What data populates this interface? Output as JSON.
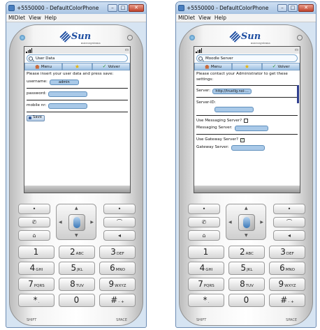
{
  "windows": [
    {
      "title": "+5550000 - DefaultColorPhone",
      "menu": [
        "MIDlet",
        "View",
        "Help"
      ],
      "search_label": "User Data",
      "nav": {
        "menu": "Menu",
        "back": "Volver"
      },
      "intro": "Please insert your user data and press save:",
      "fields": [
        {
          "label": "username:",
          "value": "admin"
        },
        {
          "label": "password:",
          "value": ""
        },
        {
          "label": "mobile nr:",
          "value": ""
        }
      ],
      "save_label": "Save"
    },
    {
      "title": "+5550000 - DefaultColorPhone",
      "menu": [
        "MIDlet",
        "View",
        "Help"
      ],
      "search_label": "Moodle Server",
      "nav": {
        "menu": "Menu",
        "back": "Volver"
      },
      "intro": "Please contact your Administrator to get these settings:",
      "server": {
        "label": "Server:",
        "value": "http://trustlg.noi-..."
      },
      "server_id": {
        "label": "Server-ID:",
        "value": ""
      },
      "messaging": {
        "checkbox_label": "Use Messaging Server?",
        "checked": false,
        "server_label": "Messaging Server:",
        "value": ""
      },
      "gateway": {
        "checkbox_label": "Use Gateway Server?",
        "checked": true,
        "server_label": "Gateway Server:",
        "value": ""
      }
    }
  ],
  "phone": {
    "brand": "Sun",
    "brand_sub": "microsystems",
    "keys": [
      {
        "n": "1",
        "l": ""
      },
      {
        "n": "2",
        "l": "ABC"
      },
      {
        "n": "3",
        "l": "DEF"
      },
      {
        "n": "4",
        "l": "GHI"
      },
      {
        "n": "5",
        "l": "JKL"
      },
      {
        "n": "6",
        "l": "MNO"
      },
      {
        "n": "7",
        "l": "PQRS"
      },
      {
        "n": "8",
        "l": "TUV"
      },
      {
        "n": "9",
        "l": "WXYZ"
      },
      {
        "n": "*",
        "l": "."
      },
      {
        "n": "0",
        "l": ""
      },
      {
        "n": "#",
        "l": "- +"
      }
    ],
    "shift_label": "SHIFT",
    "space_label": "SPACE"
  }
}
